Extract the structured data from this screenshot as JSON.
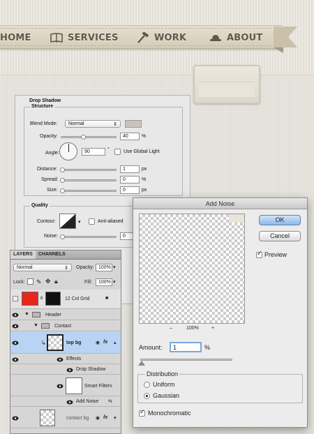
{
  "nav": {
    "items": [
      {
        "label": "HOME",
        "icon": "home-icon"
      },
      {
        "label": "SERVICES",
        "icon": "book-icon"
      },
      {
        "label": "WORK",
        "icon": "hammer-icon"
      },
      {
        "label": "ABOUT",
        "icon": "hat-icon"
      }
    ]
  },
  "layer_style": {
    "section_title": "Drop Shadow",
    "structure": {
      "title": "Structure",
      "blend_mode_label": "Blend Mode:",
      "blend_mode_value": "Normal",
      "opacity_label": "Opacity:",
      "opacity_value": "40",
      "opacity_unit": "%",
      "angle_label": "Angle:",
      "angle_value": "90",
      "angle_unit": "°",
      "global_light_label": "Use Global Light",
      "distance_label": "Distance:",
      "distance_value": "1",
      "distance_unit": "px",
      "spread_label": "Spread:",
      "spread_value": "0",
      "spread_unit": "%",
      "size_label": "Size:",
      "size_value": "0",
      "size_unit": "px"
    },
    "quality": {
      "title": "Quality",
      "contour_label": "Contour:",
      "anti_aliased_label": "Anti-aliased",
      "noise_label": "Noise:",
      "noise_value": "0"
    }
  },
  "layers_panel": {
    "tabs": [
      "LAYERS",
      "CHANNELS"
    ],
    "blend_mode": "Normal",
    "opacity_label": "Opacity:",
    "opacity_value": "100%",
    "lock_label": "Lock:",
    "fill_label": "Fill:",
    "fill_value": "100%",
    "rows": {
      "grid": "12 Col Grid",
      "header": "Header",
      "contact": "Contact",
      "top_bg": "top bg",
      "effects": "Effects",
      "drop_shadow": "Drop Shadow",
      "smart_filters": "Smart Filters",
      "add_noise": "Add Noise",
      "contact_bg": "contact bg"
    }
  },
  "add_noise": {
    "title": "Add Noise",
    "ok": "OK",
    "cancel": "Cancel",
    "preview_label": "Preview",
    "zoom_minus": "–",
    "zoom_value": "100%",
    "zoom_plus": "+",
    "amount_label": "Amount:",
    "amount_value": "1",
    "amount_unit": "%",
    "amount_fraction": 0.01,
    "distribution_title": "Distribution",
    "uniform_label": "Uniform",
    "gaussian_label": "Gaussian",
    "monochromatic_label": "Monochromatic"
  },
  "colors": {
    "ribbon": "#d8d1bd",
    "grid_swatch": "#e8261b",
    "selection": "#b8d3f3"
  }
}
